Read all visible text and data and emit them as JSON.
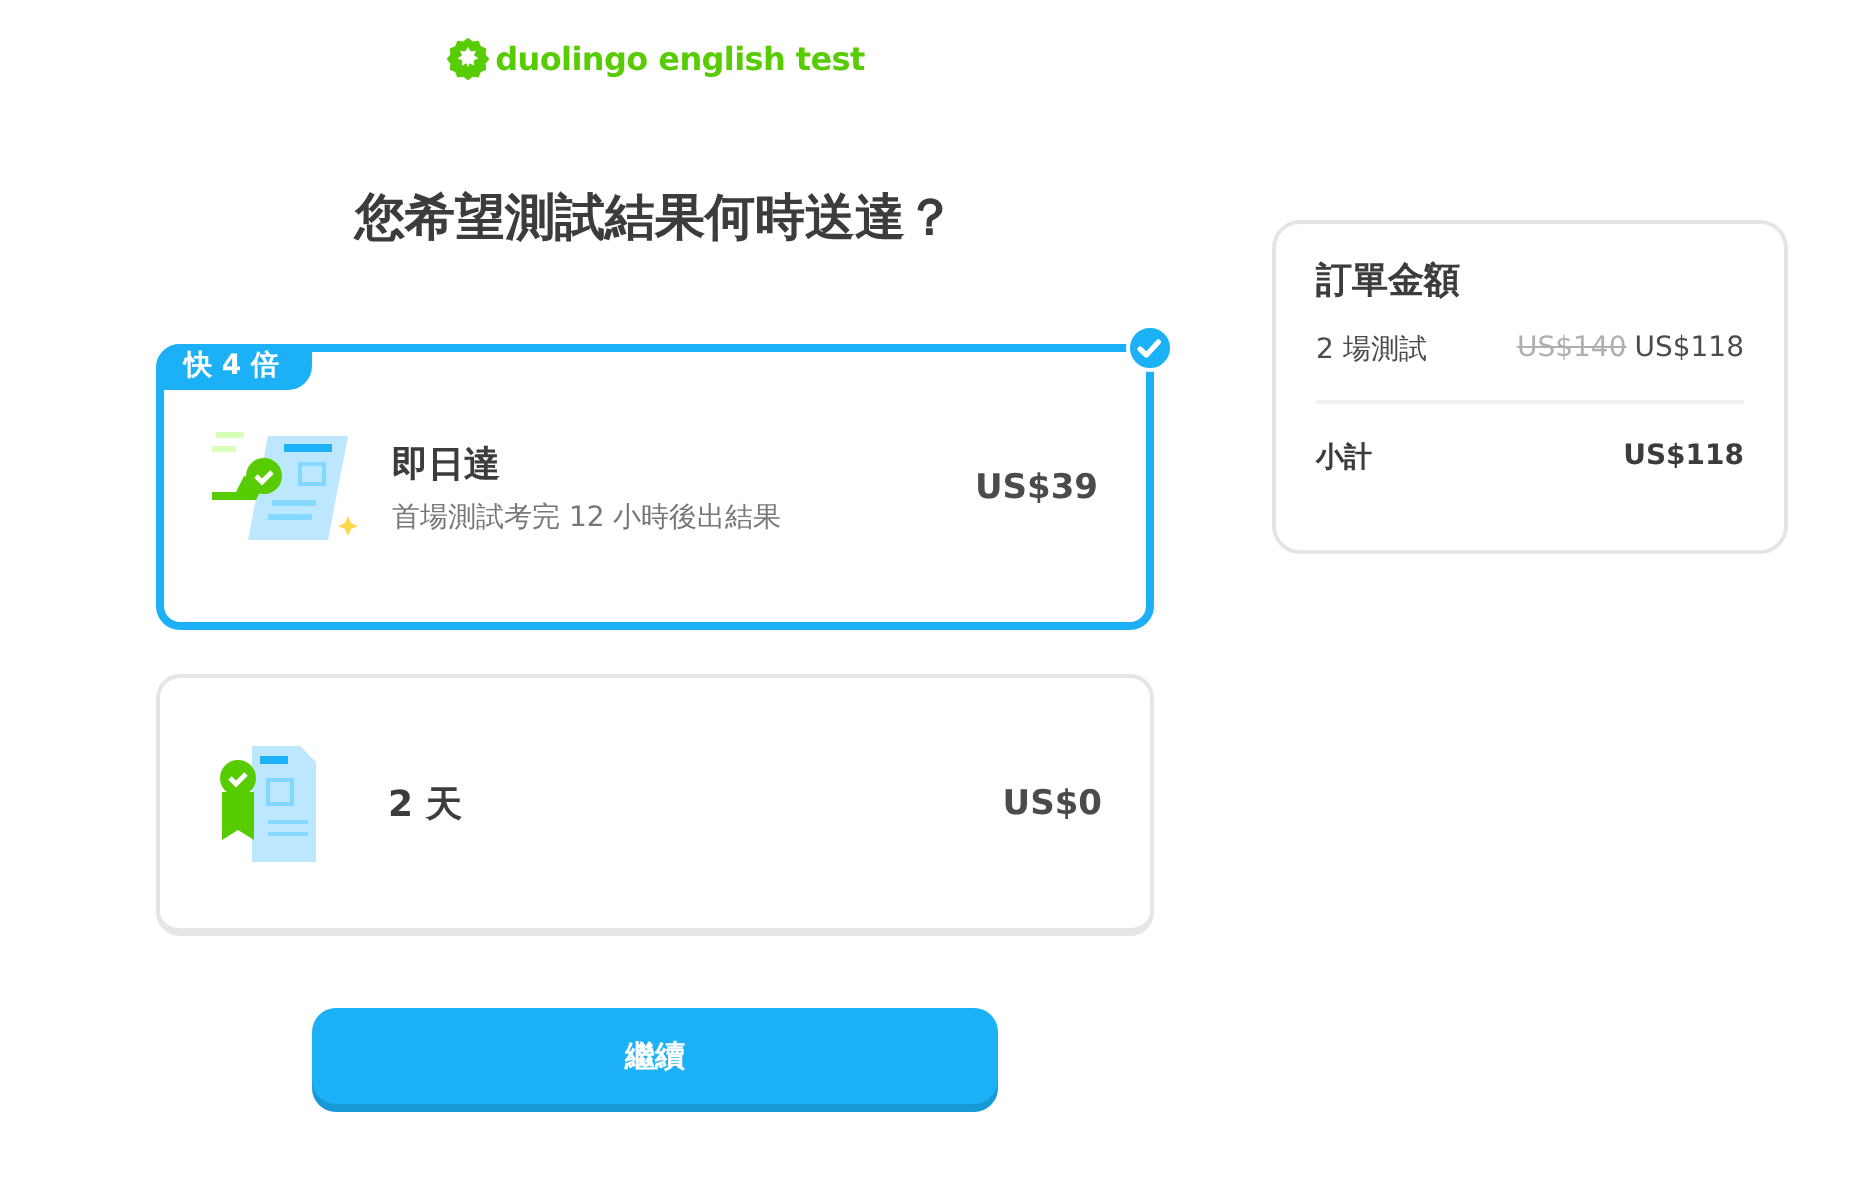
{
  "logo": {
    "text": "duolingo english test"
  },
  "question": "您希望測試結果何時送達？",
  "options": [
    {
      "kind": "fast",
      "badge": "快 4 倍",
      "title": "即日達",
      "subtitle": "首場測試考完 12 小時後出結果",
      "price": "US$39",
      "selected": true
    },
    {
      "kind": "standard",
      "title": "2 天",
      "price": "US$0",
      "selected": false
    }
  ],
  "continue_button": "繼續",
  "order": {
    "title": "訂單金額",
    "line": {
      "label": "2 場測試",
      "old_price": "US$140",
      "price": "US$118"
    },
    "subtotal": {
      "label": "小計",
      "price": "US$118"
    }
  }
}
